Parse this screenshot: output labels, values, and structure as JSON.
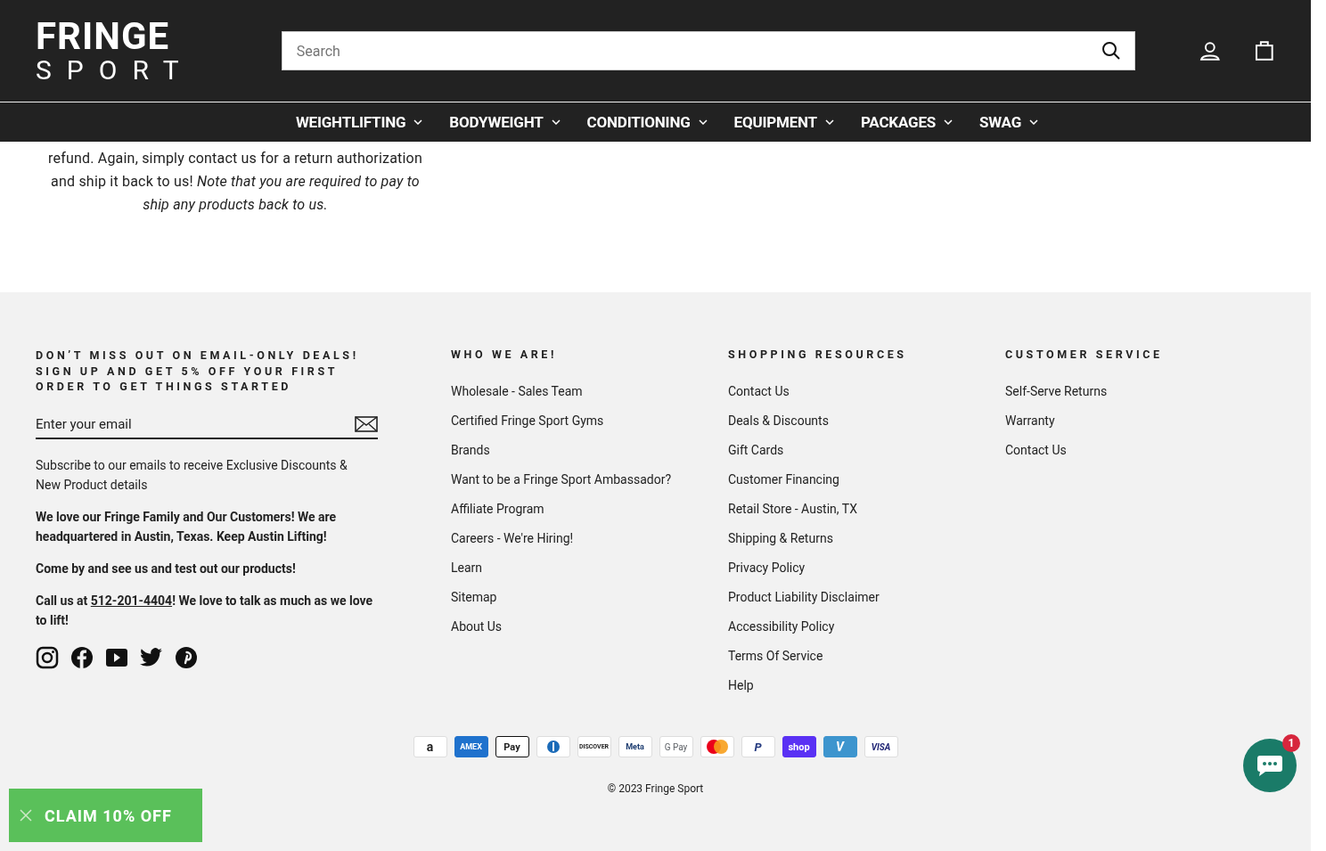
{
  "header": {
    "logo": {
      "line1": "FRINGE",
      "line2": "SPORT"
    },
    "search": {
      "placeholder": "Search"
    }
  },
  "nav": [
    {
      "label": "WEIGHTLIFTING",
      "expandable": true
    },
    {
      "label": "BODYWEIGHT",
      "expandable": true
    },
    {
      "label": "CONDITIONING",
      "expandable": true
    },
    {
      "label": "EQUIPMENT",
      "expandable": true
    },
    {
      "label": "PACKAGES",
      "expandable": true
    },
    {
      "label": "SWAG",
      "expandable": true
    }
  ],
  "article": {
    "lines": [
      "refund. Again, simply contact us for a return authorization",
      "and ship it back to us! *Note that you are required to pay to*",
      "*ship any products back to us.*"
    ]
  },
  "footer": {
    "newsletter": {
      "heading": "DON’T MISS OUT ON EMAIL-ONLY DEALS! SIGN UP AND GET 5% OFF YOUR FIRST ORDER TO GET THINGS STARTED",
      "email": {
        "placeholder": "Enter your email"
      },
      "note": "Subscribe to our emails to receive Exclusive Discounts & New Product details"
    },
    "about": [
      {
        "kind": "text",
        "text": "We love our Fringe Family and Our Customers! We are headquartered in Austin, Texas. Keep Austin Lifting!"
      },
      {
        "kind": "text",
        "text": "Come by and see us and test out our products!"
      },
      {
        "kind": "phone",
        "before": "Call us at ",
        "phone": "512-201-4404",
        "after": "! We love to talk as much as we love to lift!"
      }
    ],
    "social": [
      {
        "kind": "instagram"
      },
      {
        "kind": "facebook"
      },
      {
        "kind": "youtube"
      },
      {
        "kind": "twitter"
      },
      {
        "kind": "pinterest"
      }
    ],
    "columns": [
      {
        "title": "WHO WE ARE!",
        "links": [
          "Wholesale - Sales Team",
          "Certified Fringe Sport Gyms",
          "Brands",
          "Want to be a Fringe Sport Ambassador?",
          "Affiliate Program",
          "Careers - We're Hiring!",
          "Learn",
          "Sitemap",
          "About Us"
        ]
      },
      {
        "title": "SHOPPING RESOURCES",
        "links": [
          "Contact Us",
          "Deals & Discounts",
          "Gift Cards",
          "Customer Financing",
          "Retail Store - Austin, TX",
          "Shipping & Returns",
          "Privacy Policy",
          "Product Liability Disclaimer",
          "Accessibility Policy",
          "Terms Of Service",
          "Help"
        ]
      },
      {
        "title": "CUSTOMER SERVICE",
        "links": [
          "Self-Serve Returns",
          "Warranty",
          "Contact Us"
        ]
      }
    ],
    "payments": [
      {
        "kind": "amazon",
        "label": "a"
      },
      {
        "kind": "amex",
        "label": "AMEX"
      },
      {
        "kind": "applepay",
        "label": "Pay"
      },
      {
        "kind": "diners"
      },
      {
        "kind": "discover",
        "label": "DISCOVER"
      },
      {
        "kind": "meta",
        "label": "Meta"
      },
      {
        "kind": "gpay",
        "label": "G Pay"
      },
      {
        "kind": "mastercard"
      },
      {
        "kind": "paypal",
        "label": "P"
      },
      {
        "kind": "shop",
        "label": "shop"
      },
      {
        "kind": "venmo",
        "label": "V"
      },
      {
        "kind": "visa",
        "label": "VISA"
      }
    ],
    "copyright": "© 2023 Fringe Sport"
  },
  "promo": {
    "label": "CLAIM 10% OFF"
  },
  "chat": {
    "badge": "1"
  }
}
